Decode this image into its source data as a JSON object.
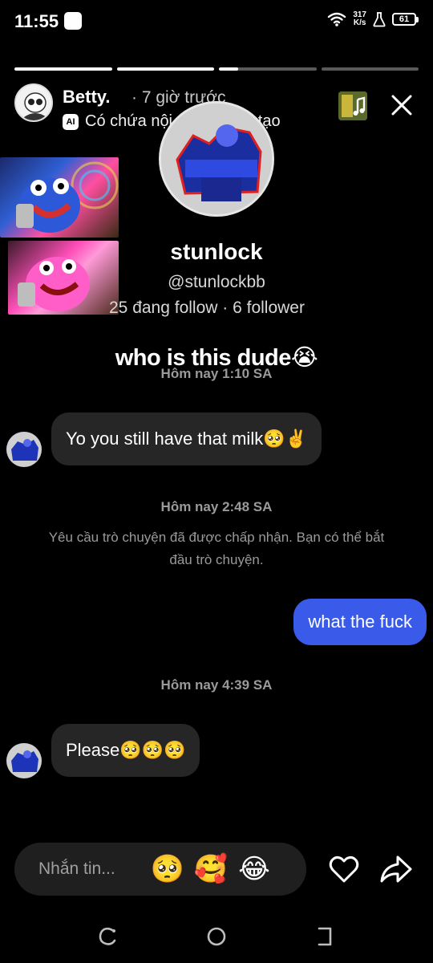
{
  "status_bar": {
    "time": "11:55",
    "net_speed_value": "317",
    "net_speed_unit": "K/s",
    "battery": "61"
  },
  "story": {
    "progress": [
      1.0,
      1.0,
      0.2,
      0.0
    ],
    "author_name": "Betty.",
    "posted_time": "· 7 giờ trước",
    "ai_badge": "AI",
    "ai_label": "Có chứa nội dung do AI tạo"
  },
  "profile": {
    "name": "stunlock",
    "handle": "@stunlockbb",
    "stats": "25 đang follow · 6 follower"
  },
  "caption": "who is this dude😭",
  "chat": {
    "timestamp_1": "Hôm nay 1:10 SA",
    "message_1": "Yo you still have that milk🥺✌️",
    "timestamp_2": "Hôm nay 2:48 SA",
    "system_message": "Yêu cầu trò chuyện đã được chấp nhận. Bạn có thể bắt đầu trò chuyện.",
    "message_2": "what the fuck",
    "timestamp_3": "Hôm nay 4:39 SA",
    "message_3": "Please🥺🥺🥺"
  },
  "reply_bar": {
    "placeholder": "Nhắn tin...",
    "quick_reactions": [
      "🥺",
      "🥰",
      "😂"
    ]
  },
  "colors": {
    "background": "#000000",
    "incoming_bubble": "#262626",
    "outgoing_bubble": "#3a5bea"
  }
}
